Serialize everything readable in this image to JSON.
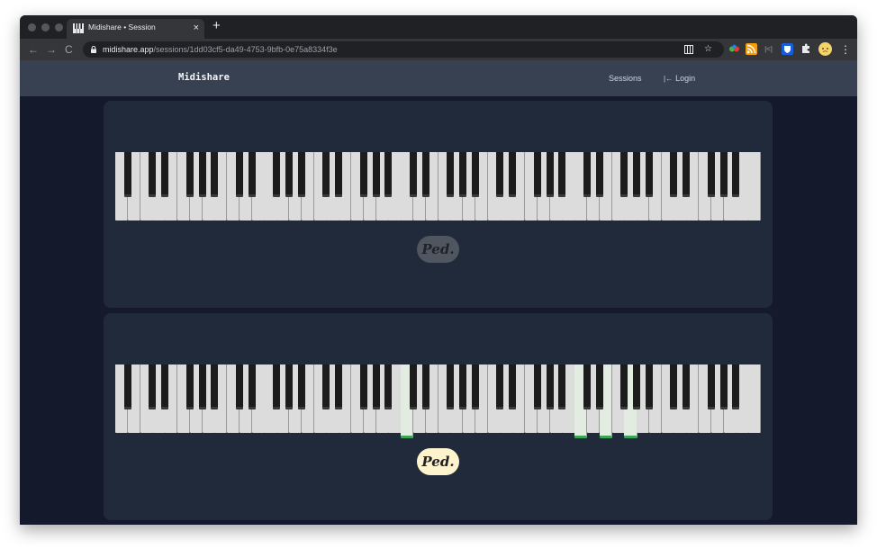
{
  "browser": {
    "tab_title": "Midishare • Session",
    "tab_close_glyph": "×",
    "new_tab_glyph": "+",
    "nav_back_glyph": "←",
    "nav_forward_glyph": "→",
    "reload_glyph": "C",
    "url_host": "midishare.app",
    "url_path": "/sessions/1dd03cf5-da49-4753-9bfb-0e75a8334f3e",
    "bookmark_glyph": "☆",
    "menu_glyph": "⋮",
    "extensions": [
      "reader-icon",
      "bookmark-star-icon",
      "colorful-extension-icon",
      "rss-icon",
      "bracket-extension-icon",
      "bitwarden-icon",
      "puzzle-extensions-icon",
      "profile-avatar"
    ]
  },
  "app": {
    "brand": "Midishare",
    "nav": {
      "sessions": "Sessions",
      "login": "Login",
      "login_icon_glyph": "|←"
    }
  },
  "pianos": [
    {
      "pedal_label": "Ped.",
      "pedal_active": false,
      "pressed_keys": []
    },
    {
      "pedal_label": "Ped.",
      "pedal_active": true,
      "pressed_keys": [
        "C4",
        "C6",
        "E6",
        "G6"
      ]
    }
  ],
  "colors": {
    "page_bg": "#141a2b",
    "nav_bg": "#374151",
    "card_bg": "#212a3b",
    "pressed_key_highlight": "#3aa555",
    "pedal_on": "#fdf3cc",
    "pedal_off": "#505660"
  }
}
